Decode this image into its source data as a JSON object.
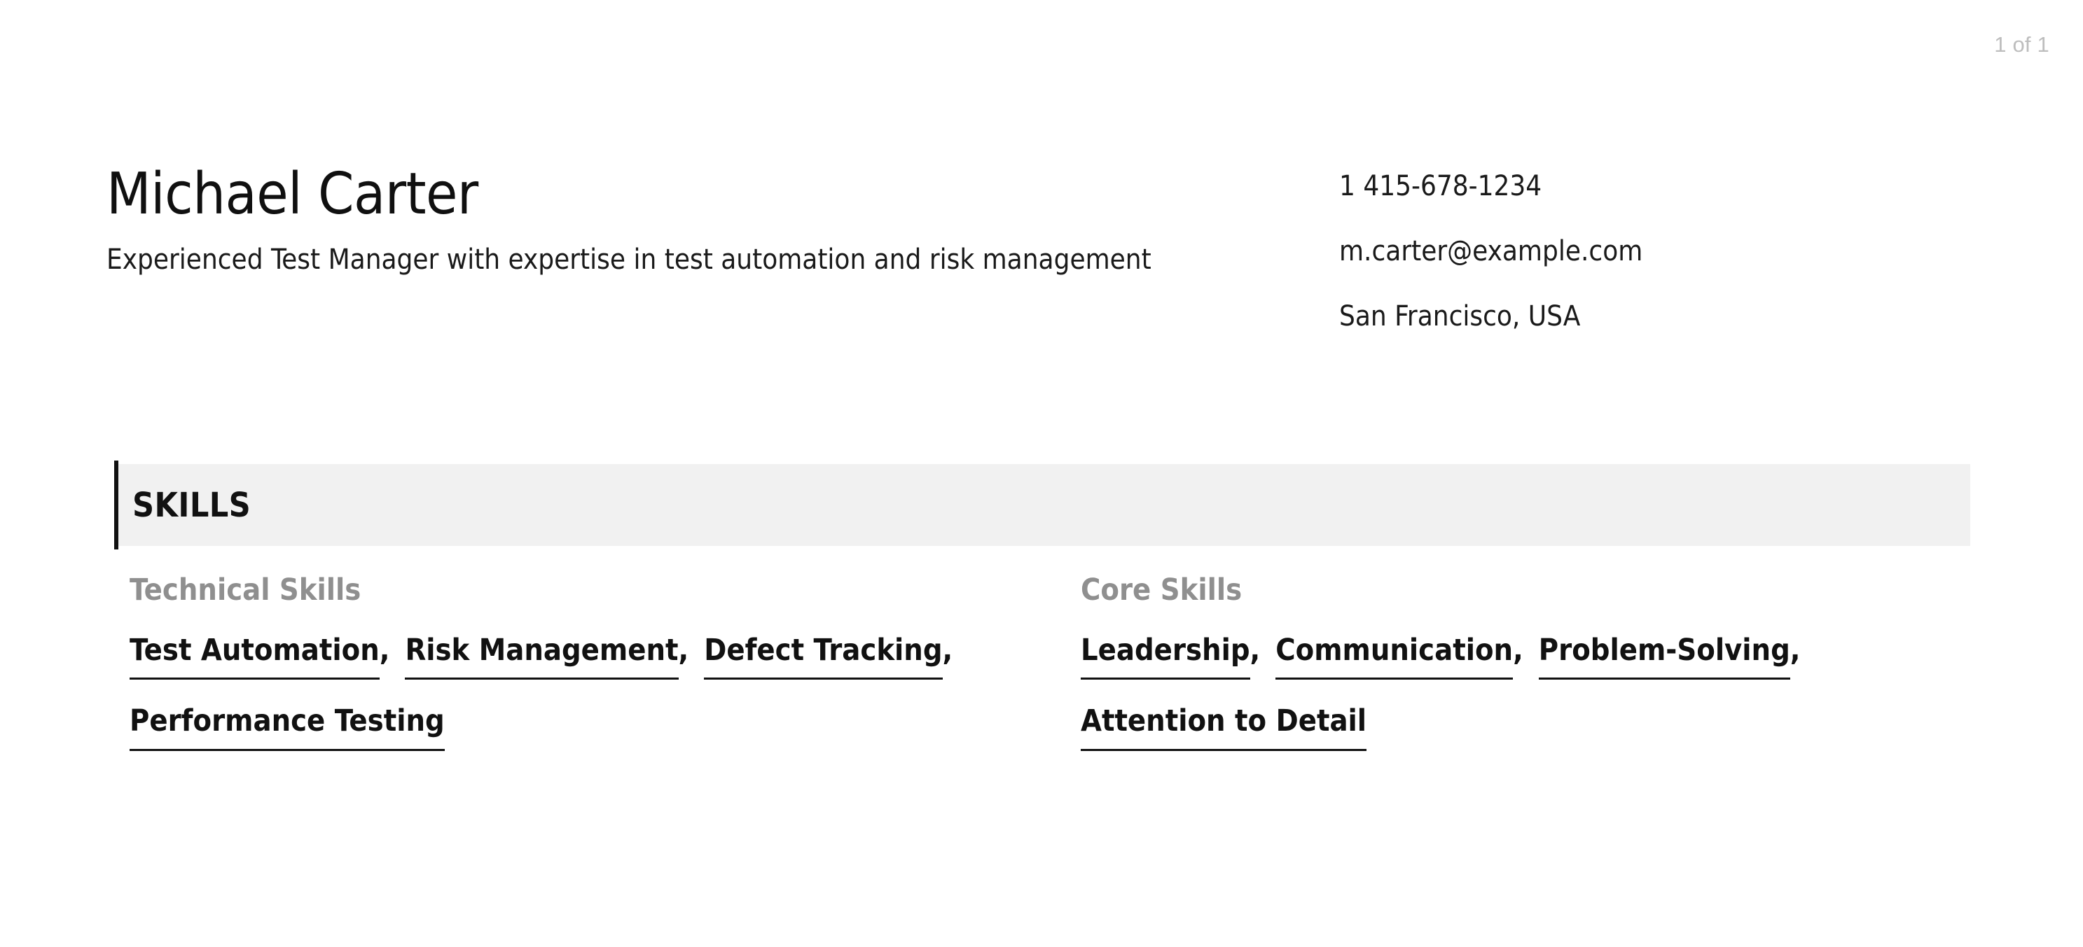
{
  "document": {
    "pagination": "1 of 1",
    "background_color": "#ffffff"
  },
  "header": {
    "full_name": "Michael Carter",
    "headline": "Experienced Test Manager with expertise in test automation and risk management",
    "contact": {
      "phone": "1 415-678-1234",
      "email": "m.carter@example.com",
      "location": "San Francisco, USA"
    }
  },
  "skills_section": {
    "title": "SKILLS",
    "band_color": "#f1f1f1",
    "accent_color": "#111111",
    "subheading_color": "#8f8f8f",
    "separator": ",",
    "groups": [
      {
        "subheading": "Technical Skills",
        "items": [
          "Test Automation",
          "Risk Management",
          "Defect Tracking",
          "Performance Testing"
        ]
      },
      {
        "subheading": "Core Skills",
        "items": [
          "Leadership",
          "Communication",
          "Problem-Solving",
          "Attention to Detail"
        ]
      }
    ]
  }
}
